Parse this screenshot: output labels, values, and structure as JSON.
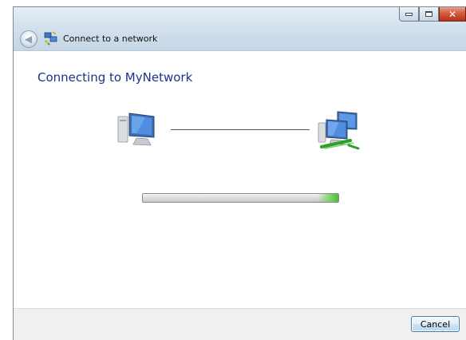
{
  "window": {
    "title": "Connect to a network",
    "icons": {
      "back": "back-arrow-icon",
      "title": "network-connection-icon",
      "minimize": "minimize-icon",
      "maximize": "maximize-icon",
      "close": "close-icon"
    }
  },
  "main": {
    "heading": "Connecting to MyNetwork",
    "icons": {
      "left": "computer-icon",
      "right": "network-computers-icon"
    },
    "progress": {
      "value": 1.0
    }
  },
  "footer": {
    "cancel_label": "Cancel"
  },
  "colors": {
    "heading": "#1e3287",
    "progress_glow": "#6fd05a",
    "close_button": "#c83f22"
  }
}
